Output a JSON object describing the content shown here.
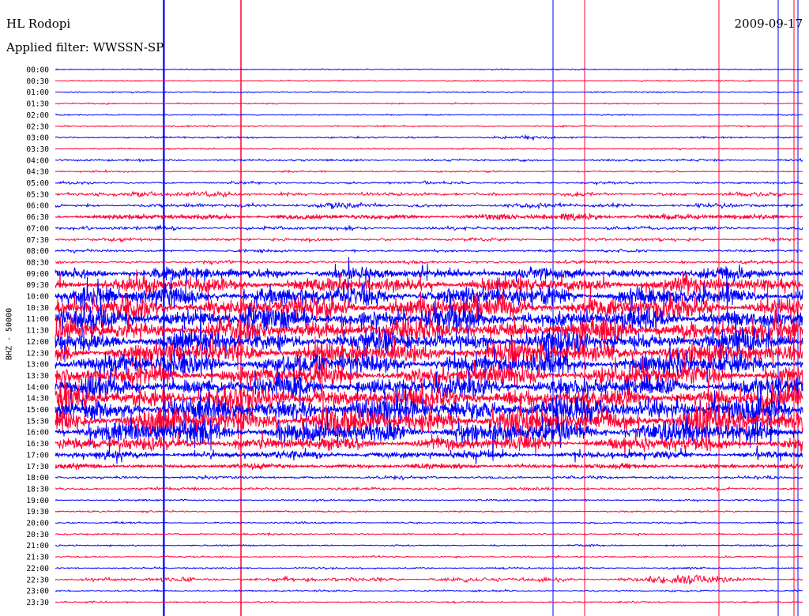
{
  "header": {
    "station": "HL Rodopi",
    "date": "2009-09-17",
    "filter": "Applied filter: WWSSN-SP"
  },
  "axis": {
    "channel": "BHZ - 50000"
  },
  "colors": {
    "traceA": "#0000ff",
    "traceB": "#ff0033",
    "background": "#ffffff",
    "text": "#000000"
  },
  "chart_data": {
    "type": "line",
    "title": "HL Rodopi",
    "subtitle": "Applied filter: WWSSN-SP",
    "ylabel": "BHZ - 50000",
    "row_labels": [
      "00:00",
      "00:30",
      "01:00",
      "01:30",
      "02:00",
      "02:30",
      "03:00",
      "03:30",
      "04:00",
      "04:30",
      "05:00",
      "05:30",
      "06:00",
      "06:30",
      "07:00",
      "07:30",
      "08:00",
      "08:30",
      "09:00",
      "09:30",
      "10:00",
      "10:30",
      "11:00",
      "11:30",
      "12:00",
      "12:30",
      "13:00",
      "13:30",
      "14:00",
      "14:30",
      "15:00",
      "15:30",
      "16:00",
      "16:30",
      "17:00",
      "17:30",
      "18:00",
      "18:30",
      "19:00",
      "19:30",
      "20:00",
      "20:30",
      "21:00",
      "21:30",
      "22:00",
      "22:30",
      "23:00",
      "23:30"
    ],
    "row_colors": [
      "blue",
      "red"
    ],
    "relative_amplitude": [
      0.3,
      0.3,
      0.3,
      0.3,
      0.3,
      0.4,
      0.6,
      0.4,
      0.8,
      0.5,
      0.9,
      1.6,
      1.6,
      2.2,
      1.4,
      1.2,
      1.0,
      1.2,
      5,
      7,
      9,
      10,
      10,
      10,
      10,
      10,
      10,
      9,
      9,
      10,
      12,
      12,
      10,
      6,
      3,
      2,
      1.2,
      1,
      0.6,
      0.5,
      0.5,
      0.5,
      0.5,
      0.5,
      0.6,
      1.8,
      0.6,
      0.5
    ],
    "events": [
      {
        "row": "22:30",
        "position": 0.85,
        "amplitude": 10
      },
      {
        "row": "05:30",
        "position": 0.12,
        "amplitude": 4
      },
      {
        "row": "06:00",
        "position": 0.37,
        "amplitude": 3
      },
      {
        "row": "06:30",
        "position": 0.7,
        "amplitude": 3
      },
      {
        "row": "03:00",
        "position": 0.63,
        "amplitude": 2
      }
    ]
  }
}
